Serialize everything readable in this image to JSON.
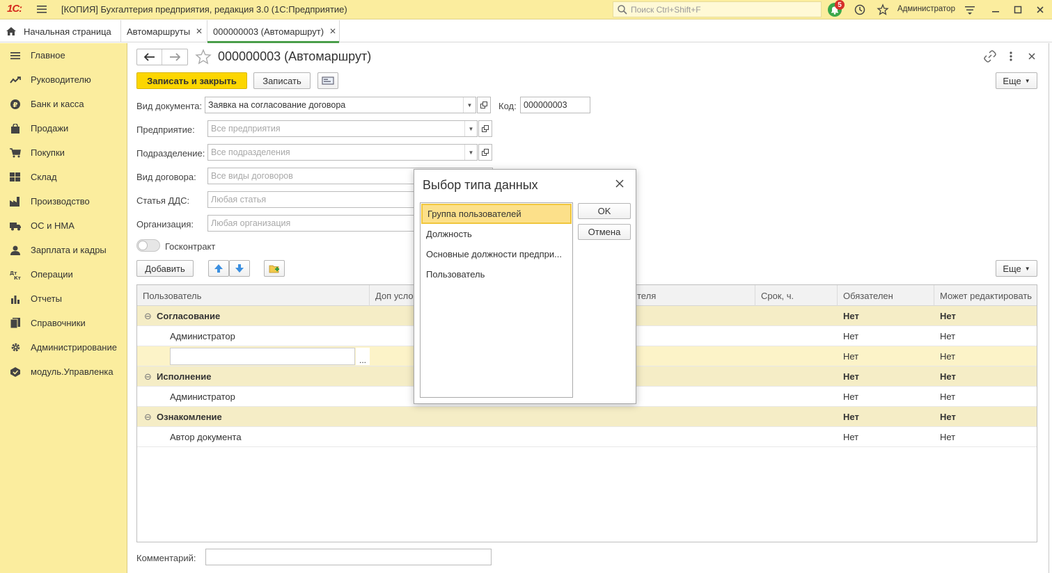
{
  "titlebar": {
    "logo": "1С:",
    "title": "[КОПИЯ] Бухгалтерия предприятия, редакция 3.0  (1С:Предприятие)",
    "search_placeholder": "Поиск Ctrl+Shift+F",
    "notifications_count": "5",
    "user": "Администратор"
  },
  "tabs": [
    {
      "label": "Начальная страница"
    },
    {
      "label": "Автомаршруты",
      "close": "✕"
    },
    {
      "label": "000000003 (Автомаршрут)",
      "close": "✕"
    }
  ],
  "sidebar": {
    "items": [
      {
        "label": "Главное",
        "icon": "menu-icon"
      },
      {
        "label": "Руководителю",
        "icon": "trend-icon"
      },
      {
        "label": "Банк и касса",
        "icon": "ruble-icon"
      },
      {
        "label": "Продажи",
        "icon": "bag-icon"
      },
      {
        "label": "Покупки",
        "icon": "cart-icon"
      },
      {
        "label": "Склад",
        "icon": "warehouse-icon"
      },
      {
        "label": "Производство",
        "icon": "factory-icon"
      },
      {
        "label": "ОС и НМА",
        "icon": "truck-icon"
      },
      {
        "label": "Зарплата и кадры",
        "icon": "person-icon"
      },
      {
        "label": "Операции",
        "icon": "dtkt-icon"
      },
      {
        "label": "Отчеты",
        "icon": "chart-icon"
      },
      {
        "label": "Справочники",
        "icon": "book-icon"
      },
      {
        "label": "Администрирование",
        "icon": "gear-icon"
      },
      {
        "label": "модуль.Управленка",
        "icon": "module-icon"
      }
    ]
  },
  "form": {
    "title": "000000003 (Автомаршрут)",
    "save_close": "Записать и закрыть",
    "save": "Записать",
    "more": "Еще",
    "fields": {
      "doc_type_label": "Вид документа:",
      "doc_type_value": "Заявка на согласование договора",
      "code_label": "Код:",
      "code_value": "000000003",
      "enterprise_label": "Предприятие:",
      "enterprise_placeholder": "Все предприятия",
      "division_label": "Подразделение:",
      "division_placeholder": "Все подразделения",
      "contract_type_label": "Вид договора:",
      "contract_type_placeholder": "Все виды договоров",
      "dds_label": "Статья ДДС:",
      "dds_placeholder": "Любая статья",
      "org_label": "Организация:",
      "org_placeholder": "Любая организация",
      "goscontract_label": "Госконтракт",
      "comment_label": "Комментарий:"
    },
    "table_toolbar": {
      "add": "Добавить",
      "more": "Еще"
    }
  },
  "table": {
    "columns": [
      "Пользователь",
      "Доп усло",
      "теля",
      "Срок, ч.",
      "Обязателен",
      "Может редактировать"
    ],
    "rows": [
      {
        "type": "group",
        "user": "Согласование",
        "toggle": "⊖",
        "required": "Нет",
        "can_edit": "Нет"
      },
      {
        "type": "item",
        "user": "Администратор",
        "required": "Нет",
        "can_edit": "Нет"
      },
      {
        "type": "edit",
        "user": "",
        "ellipsis": "...",
        "required": "Нет",
        "can_edit": "Нет"
      },
      {
        "type": "group",
        "user": "Исполнение",
        "toggle": "⊖",
        "required": "Нет",
        "can_edit": "Нет"
      },
      {
        "type": "item",
        "user": "Администратор",
        "required": "Нет",
        "can_edit": "Нет"
      },
      {
        "type": "group",
        "user": "Ознакомление",
        "toggle": "⊖",
        "required": "Нет",
        "can_edit": "Нет"
      },
      {
        "type": "item",
        "user": "Автор документа",
        "required": "Нет",
        "can_edit": "Нет"
      }
    ]
  },
  "dialog": {
    "title": "Выбор типа данных",
    "items": [
      "Группа пользователей",
      "Должность",
      "Основные должности предпри...",
      "Пользователь"
    ],
    "selected_index": 0,
    "ok": "OK",
    "cancel": "Отмена"
  },
  "colors": {
    "accent_yellow": "#fbed9e",
    "button_yellow": "#fcd600",
    "tab_underline": "#4a9e4a",
    "bell_green": "#3aa84a",
    "badge_red": "#d6302a"
  }
}
